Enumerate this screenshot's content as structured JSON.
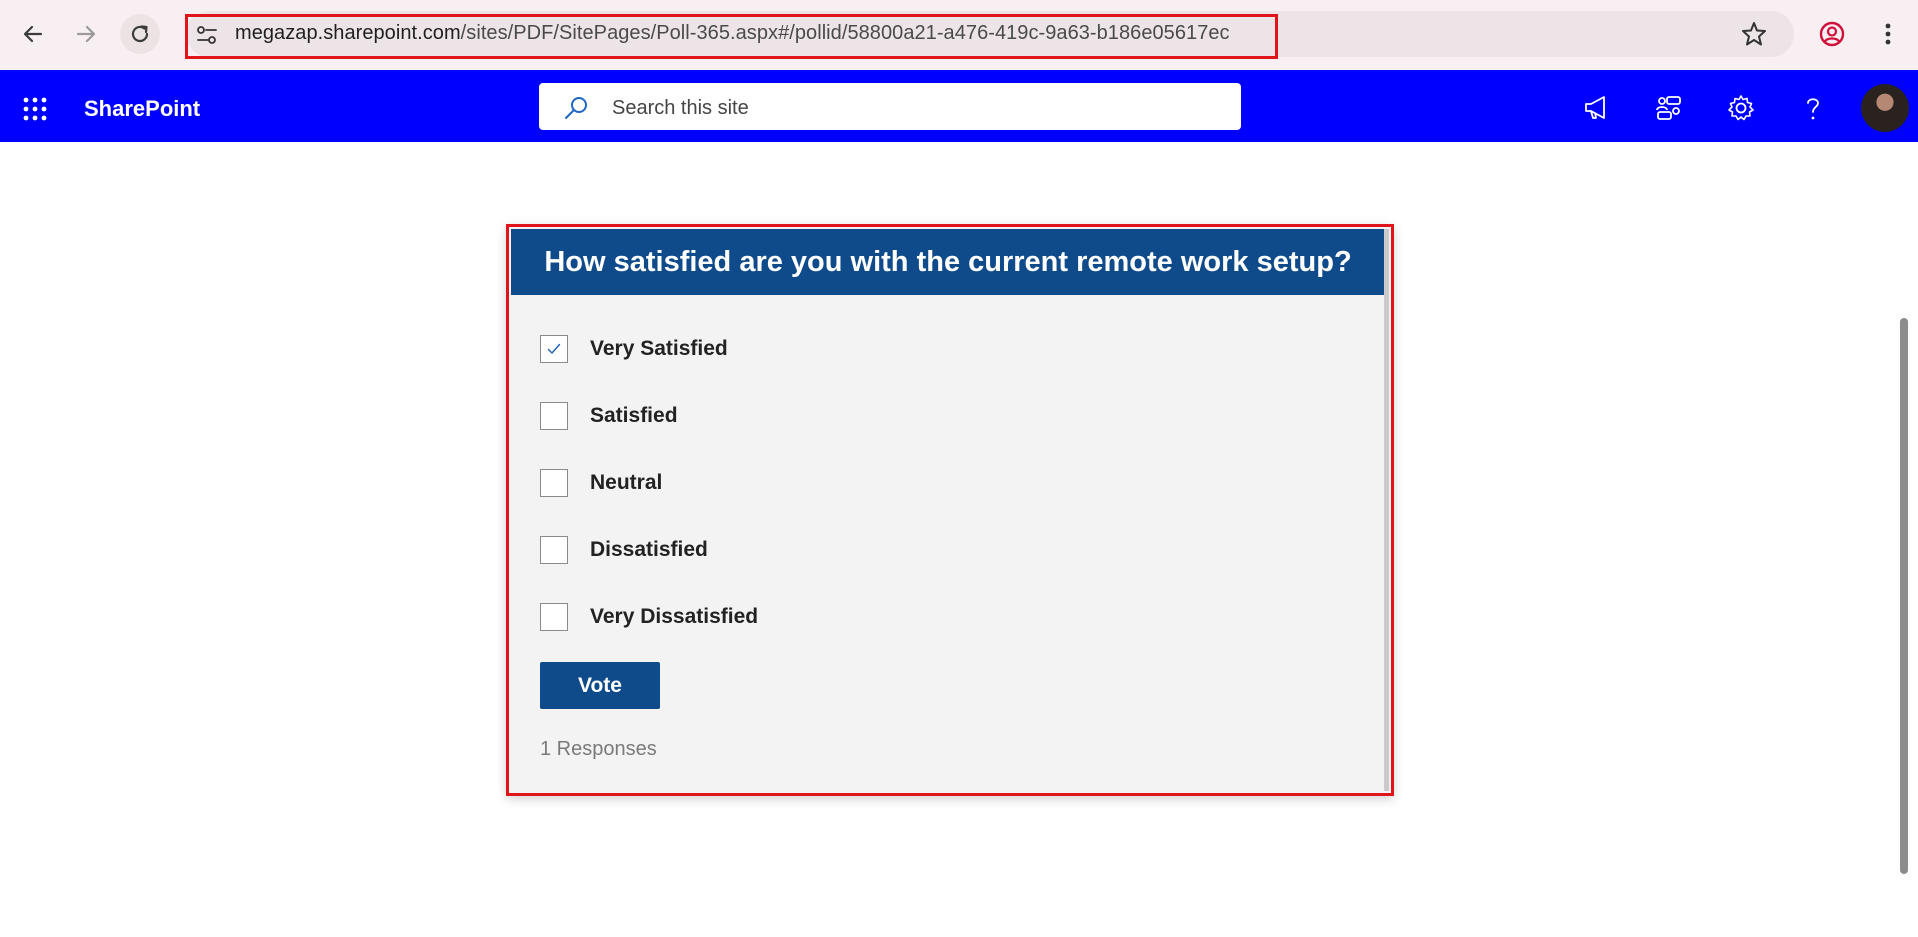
{
  "browser": {
    "url_host": "megazap.sharepoint.com",
    "url_path": "/sites/PDF/SitePages/Poll-365.aspx#/pollid/58800a21-a476-419c-9a63-b186e05617ec"
  },
  "suite_bar": {
    "brand": "SharePoint",
    "search_placeholder": "Search this site",
    "background_color": "#0000ff"
  },
  "poll": {
    "question": "How satisfied are you with the current remote work setup?",
    "options": [
      {
        "label": "Very Satisfied",
        "checked": true
      },
      {
        "label": "Satisfied",
        "checked": false
      },
      {
        "label": "Neutral",
        "checked": false
      },
      {
        "label": "Dissatisfied",
        "checked": false
      },
      {
        "label": "Very Dissatisfied",
        "checked": false
      }
    ],
    "vote_label": "Vote",
    "responses_text": "1 Responses",
    "accent_color": "#0f4b8a"
  },
  "icons": {
    "back": "back-arrow-icon",
    "forward": "forward-arrow-icon",
    "reload": "reload-icon",
    "site_info": "site-settings-icon",
    "bookmark": "star-icon",
    "profile": "profile-icon",
    "menu": "kebab-menu-icon",
    "waffle": "app-launcher-icon",
    "search": "search-icon",
    "news": "megaphone-icon",
    "activity": "activity-icon",
    "settings": "gear-icon",
    "help": "help-icon"
  }
}
